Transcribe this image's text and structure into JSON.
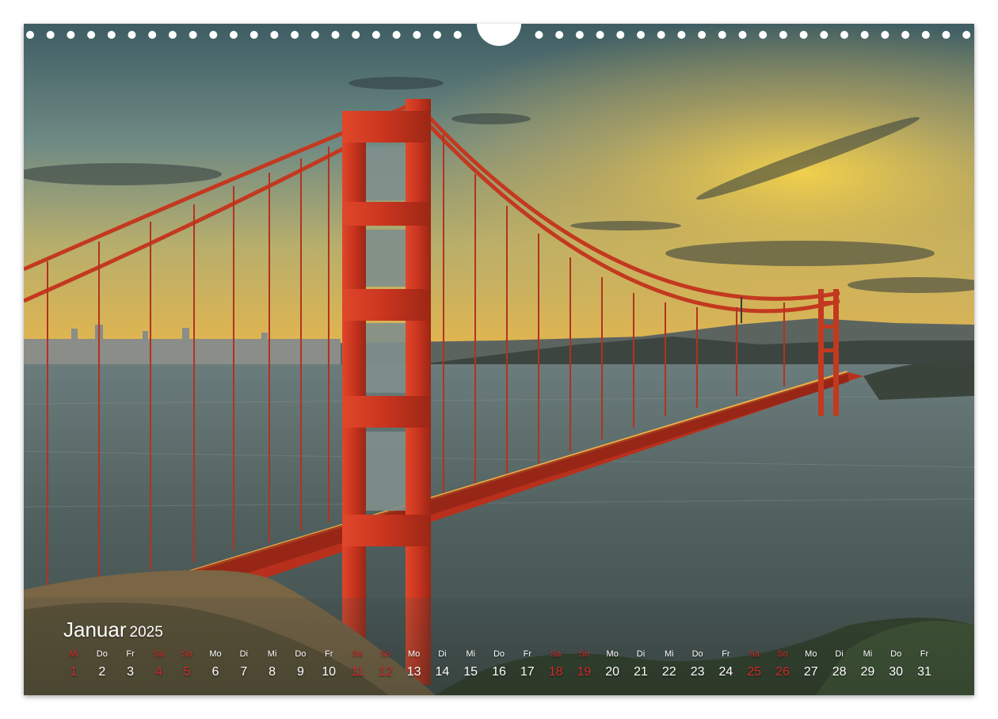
{
  "calendar": {
    "month": "Januar",
    "year": "2025",
    "days": [
      {
        "wd": "Mi",
        "d": "1",
        "we": true
      },
      {
        "wd": "Do",
        "d": "2",
        "we": false
      },
      {
        "wd": "Fr",
        "d": "3",
        "we": false
      },
      {
        "wd": "Sa",
        "d": "4",
        "we": true
      },
      {
        "wd": "So",
        "d": "5",
        "we": true
      },
      {
        "wd": "Mo",
        "d": "6",
        "we": false
      },
      {
        "wd": "Di",
        "d": "7",
        "we": false
      },
      {
        "wd": "Mi",
        "d": "8",
        "we": false
      },
      {
        "wd": "Do",
        "d": "9",
        "we": false
      },
      {
        "wd": "Fr",
        "d": "10",
        "we": false
      },
      {
        "wd": "Sa",
        "d": "11",
        "we": true
      },
      {
        "wd": "So",
        "d": "12",
        "we": true
      },
      {
        "wd": "Mo",
        "d": "13",
        "we": false
      },
      {
        "wd": "Di",
        "d": "14",
        "we": false
      },
      {
        "wd": "Mi",
        "d": "15",
        "we": false
      },
      {
        "wd": "Do",
        "d": "16",
        "we": false
      },
      {
        "wd": "Fr",
        "d": "17",
        "we": false
      },
      {
        "wd": "Sa",
        "d": "18",
        "we": true
      },
      {
        "wd": "So",
        "d": "19",
        "we": true
      },
      {
        "wd": "Mo",
        "d": "20",
        "we": false
      },
      {
        "wd": "Di",
        "d": "21",
        "we": false
      },
      {
        "wd": "Mi",
        "d": "22",
        "we": false
      },
      {
        "wd": "Do",
        "d": "23",
        "we": false
      },
      {
        "wd": "Fr",
        "d": "24",
        "we": false
      },
      {
        "wd": "Sa",
        "d": "25",
        "we": true
      },
      {
        "wd": "So",
        "d": "26",
        "we": true
      },
      {
        "wd": "Mo",
        "d": "27",
        "we": false
      },
      {
        "wd": "Di",
        "d": "28",
        "we": false
      },
      {
        "wd": "Mi",
        "d": "29",
        "we": false
      },
      {
        "wd": "Do",
        "d": "30",
        "we": false
      },
      {
        "wd": "Fr",
        "d": "31",
        "we": false
      }
    ]
  },
  "photo": {
    "subject": "golden-gate-bridge-at-sunset",
    "colors": {
      "bridge": "#c8341e",
      "sky_top": "#3e5c63",
      "sky_glow": "#f0c33a",
      "water": "#4a5a58"
    }
  }
}
